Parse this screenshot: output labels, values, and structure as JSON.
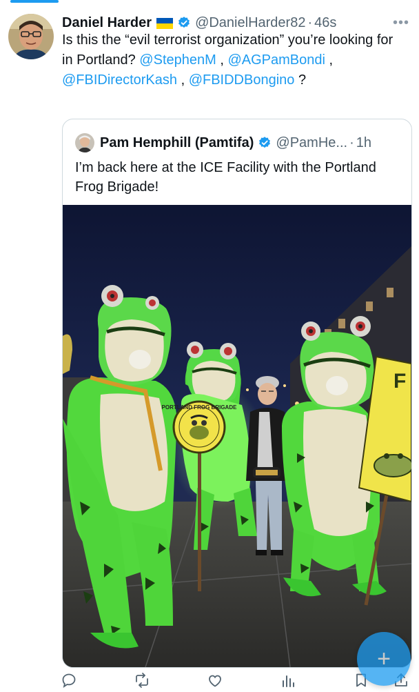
{
  "tweet": {
    "author_name": "Daniel Harder",
    "handle": "@DanielHarder82",
    "separator": "·",
    "time": "46s",
    "text_start": "Is this the “evil terrorist organization” you’re looking for in Portland? ",
    "mentions": [
      "@StephenM",
      "@AGPamBondi",
      "@FBIDirectorKash",
      "@FBIDDBongino"
    ],
    "sep_comma": " , ",
    "text_end": " ?"
  },
  "quote": {
    "author_name": "Pam Hemphill (Pamtifa)",
    "handle": "@PamHe...",
    "separator": "·",
    "time": "1h",
    "text": "I’m back here at the ICE Facility with the Portland Frog Brigade!"
  },
  "photo": {
    "sign_text": "PORTLAND FROG BRIGADE",
    "side_sign_text": "F TO ST"
  },
  "colors": {
    "accent": "#1d9bf0",
    "frog_green": "#4bd43c",
    "night_sky": "#1b2448"
  },
  "icons": [
    "more-icon",
    "verified-icon",
    "flag-icon",
    "reply-icon",
    "retweet-icon",
    "like-icon",
    "views-icon",
    "bookmark-icon",
    "share-icon",
    "compose-icon"
  ]
}
